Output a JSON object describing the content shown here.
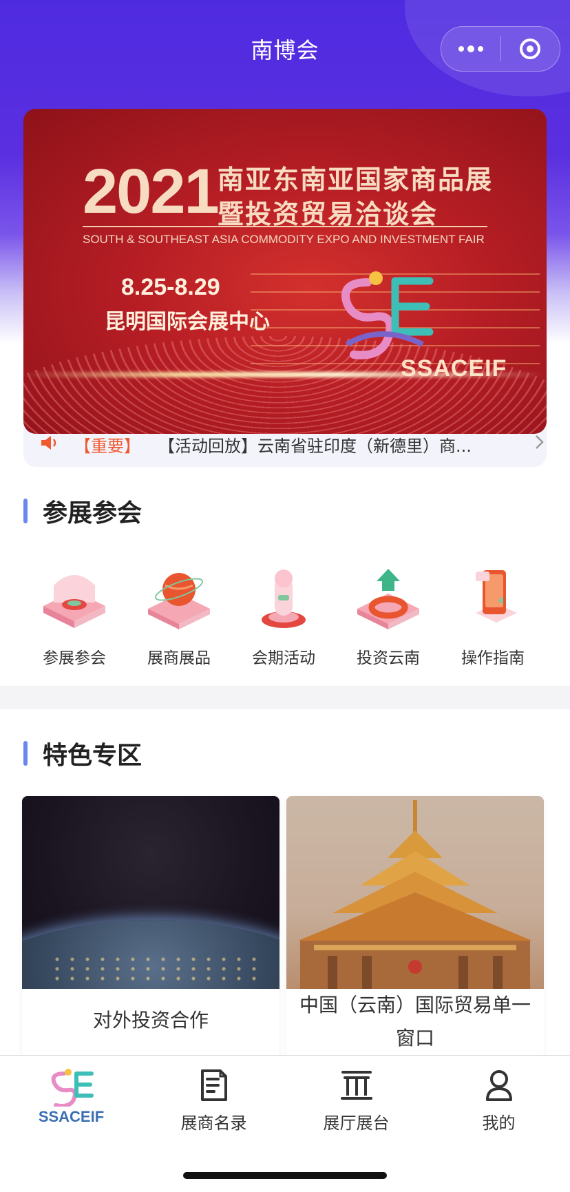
{
  "nav": {
    "title": "南博会"
  },
  "banner": {
    "year": "2021",
    "title_line1": "南亚东南亚国家商品展",
    "title_line2": "暨投资贸易洽谈会",
    "subtitle_en": "SOUTH & SOUTHEAST ASIA COMMODITY EXPO AND INVESTMENT FAIR",
    "dates": "8.25-8.29",
    "venue": "昆明国际会展中心",
    "logo_text": "SSACEIF",
    "colors": {
      "background": "#b51d24",
      "text": "#f7dcc2"
    }
  },
  "notice": {
    "tag": "【重要】",
    "text": "【活动回放】云南省驻印度（新德里）商...",
    "icon": "speaker-icon",
    "chevron": "chevron-right-icon"
  },
  "section_participate": {
    "title": "参展参会",
    "items": [
      {
        "label": "参展参会",
        "icon": "exhibit-attend-icon"
      },
      {
        "label": "展商展品",
        "icon": "exhibitor-products-icon"
      },
      {
        "label": "会期活动",
        "icon": "event-activities-icon"
      },
      {
        "label": "投资云南",
        "icon": "invest-yunnan-icon"
      },
      {
        "label": "操作指南",
        "icon": "operation-guide-icon"
      }
    ]
  },
  "section_feature": {
    "title": "特色专区",
    "cards": [
      {
        "caption": "对外投资合作"
      },
      {
        "caption": "中国（云南）国际贸易单一窗口"
      }
    ]
  },
  "tabbar": {
    "items": [
      {
        "label": "SSACEIF",
        "icon": "ssaceif-logo-icon"
      },
      {
        "label": "展商名录",
        "icon": "directory-icon"
      },
      {
        "label": "展厅展台",
        "icon": "hall-icon"
      },
      {
        "label": "我的",
        "icon": "profile-icon"
      }
    ]
  },
  "theme": {
    "accent": "#6c86f0",
    "nav_gradient_top": "#4f2be0",
    "notice_tag": "#f0582f"
  }
}
